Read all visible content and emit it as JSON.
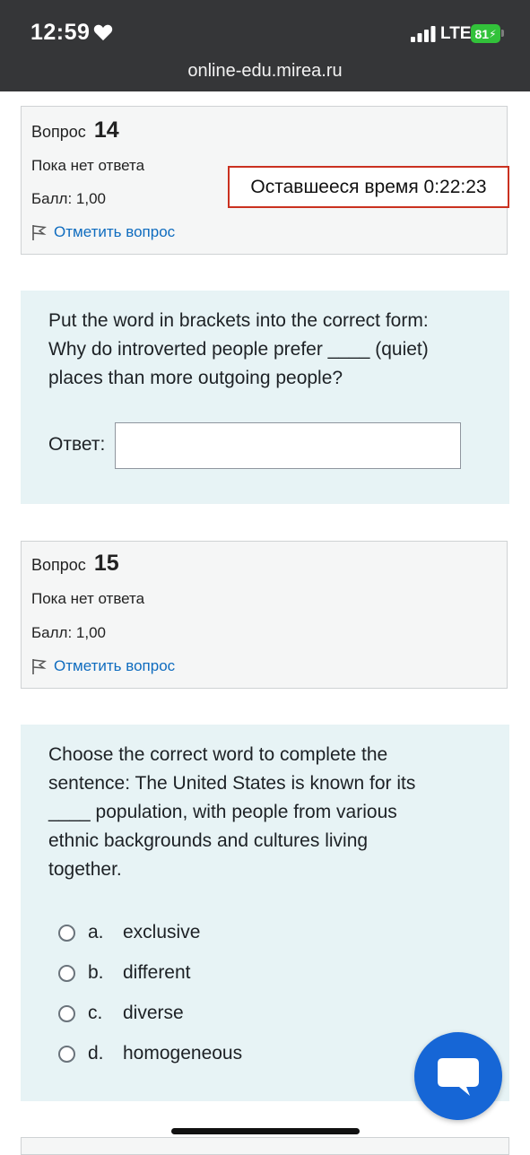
{
  "status_bar": {
    "time": "12:59",
    "network": "LTE",
    "battery": "81"
  },
  "browser": {
    "url": "online-edu.mirea.ru"
  },
  "timer": {
    "text": "Оставшееся время 0:22:23"
  },
  "questions": [
    {
      "label": "Вопрос",
      "number": "14",
      "state": "Пока нет ответа",
      "grade": "Балл: 1,00",
      "flag_label": "Отметить вопрос",
      "text_lines": [
        "Put the word in brackets into the correct form:",
        "Why do introverted people prefer ____ (quiet)",
        "places than more outgoing people?"
      ],
      "answer_label": "Ответ:",
      "answer_value": ""
    },
    {
      "label": "Вопрос",
      "number": "15",
      "state": "Пока нет ответа",
      "grade": "Балл: 1,00",
      "flag_label": "Отметить вопрос",
      "text_lines": [
        "Choose the correct word to complete the",
        "sentence: The United States is known for its",
        "____ population, with people from various",
        "ethnic backgrounds and cultures living",
        "together."
      ],
      "options": [
        {
          "letter": "a.",
          "text": "exclusive"
        },
        {
          "letter": "b.",
          "text": "different"
        },
        {
          "letter": "c.",
          "text": "diverse"
        },
        {
          "letter": "d.",
          "text": "homogeneous"
        }
      ]
    }
  ],
  "icons": {
    "flag": "flag-icon",
    "chat": "chat-bubble-icon",
    "heart": "heart-icon",
    "signal": "signal-bars-icon"
  },
  "colors": {
    "link": "#0f6cbf",
    "timer_border": "#ca3120",
    "question_bg": "#e7f3f5",
    "info_bg": "#f5f6f6",
    "fab": "#1666d6",
    "battery": "#32c23a"
  }
}
